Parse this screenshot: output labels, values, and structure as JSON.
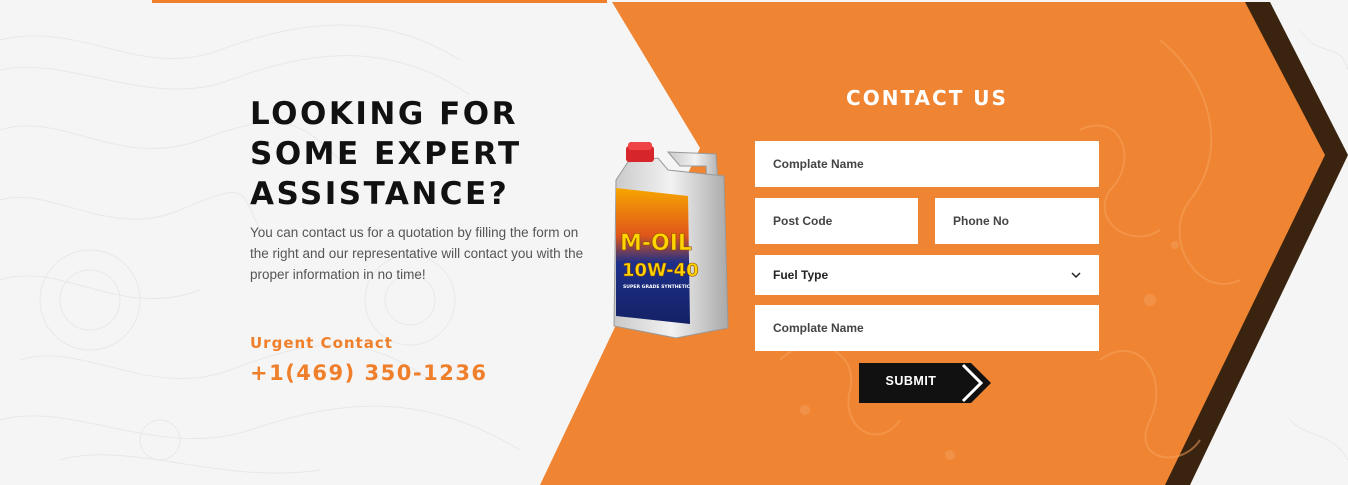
{
  "hero": {
    "heading": "LOOKING FOR SOME EXPERT ASSISTANCE?",
    "description": "You can contact us for a quotation by filling the form on the right and our representative will contact you with the proper information in no time!",
    "urgent_label": "Urgent Contact",
    "urgent_phone": "+1(469) 350-1236"
  },
  "bottle": {
    "brand": "M-OIL",
    "grade": "10W-40",
    "subtitle": "SUPER GRADE SYNTHETIC"
  },
  "form": {
    "title": "CONTACT US",
    "name_placeholder": "Complate Name",
    "postcode_placeholder": "Post Code",
    "phone_placeholder": "Phone No",
    "fuel_type_selected": "Fuel Type",
    "message_placeholder": "Complate Name",
    "submit_label": "SUBMIT"
  },
  "colors": {
    "accent": "#ef7f2a",
    "dark_edge": "#3a2410",
    "button": "#111111"
  }
}
